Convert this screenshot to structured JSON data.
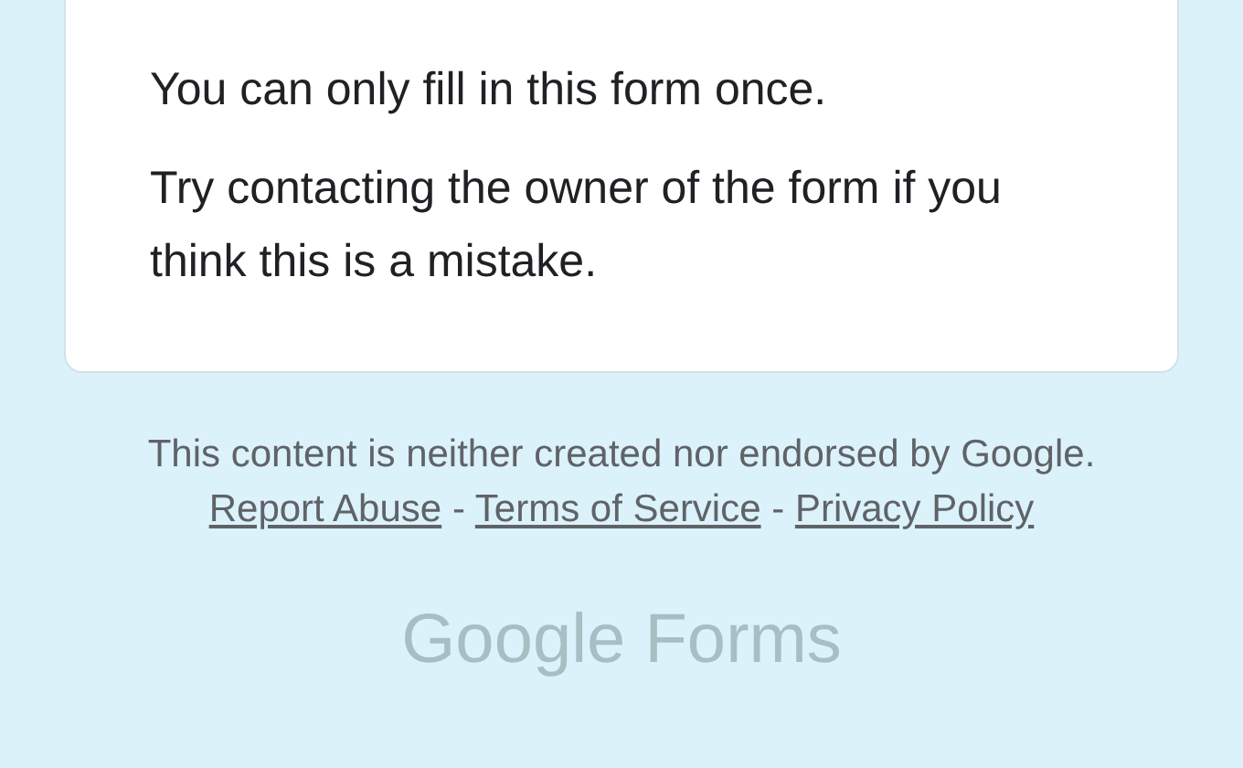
{
  "message": {
    "paragraphs": [
      "You can only fill in this form once.",
      "Try contacting the owner of the form if you think this is a mistake."
    ]
  },
  "footer": {
    "disclaimer": "This content is neither created nor endorsed by Google.",
    "links": [
      {
        "label": "Report Abuse"
      },
      {
        "label": "Terms of Service"
      },
      {
        "label": "Privacy Policy"
      }
    ],
    "separator": "-"
  },
  "logo": {
    "text": "Google Forms"
  }
}
